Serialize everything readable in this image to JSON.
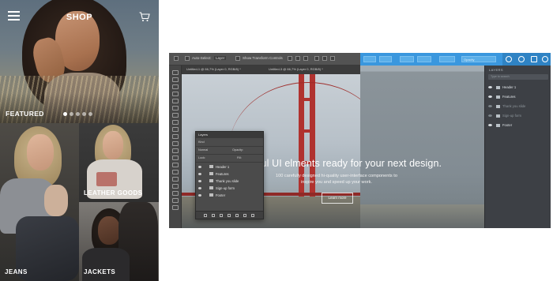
{
  "shop": {
    "title": "SHOP",
    "featured_label": "FEATURED",
    "carousel": {
      "slides": 5,
      "active_index": 0
    },
    "categories": {
      "leather_goods": "LEATHER GOODS",
      "jeans": "JEANS",
      "jackets": "JACKETS"
    },
    "icons": {
      "menu": "hamburger-menu-icon",
      "cart": "shopping-cart-icon"
    }
  },
  "editor": {
    "options_bar": {
      "auto_select": "Auto-Select:",
      "auto_select_value": "Layer",
      "show_transform": "Show Transform Controls"
    },
    "doc_tabs": [
      "Untitled-1 @ 66,7% (Layer 0, RGB/8) *",
      "Untitled-3 @ 66,7% (Layer 0, RGB/8) *"
    ],
    "hero_title": "ful UI elments ready for your next design.",
    "hero_subtitle": "100 carefully designed hi-quality user-interface components to inspire you and speed up your work.",
    "hero_button": "Learn more",
    "floating_layers": {
      "tab": "Layers",
      "kind": "Kind",
      "mode": "Normal",
      "opacity_label": "Opacity:",
      "lock_label": "Lock:",
      "fill_label": "Fill:",
      "layers": [
        "Header 1",
        "Features",
        "Thank you slide",
        "Sign-up form",
        "Footer"
      ]
    },
    "layers_panel": {
      "title": "LAYERS",
      "search_placeholder": "Type to search",
      "rows": [
        {
          "name": "Header 1",
          "dim": false
        },
        {
          "name": "Features",
          "dim": false
        },
        {
          "name": "Thank you slide",
          "dim": true
        },
        {
          "name": "Sign-up form",
          "dim": true
        },
        {
          "name": "Footer",
          "dim": false
        }
      ]
    },
    "header_fields": [
      "",
      "",
      "",
      "Opacity"
    ],
    "colors": {
      "accent": "#3a97de",
      "tower": "#b0322f"
    }
  }
}
